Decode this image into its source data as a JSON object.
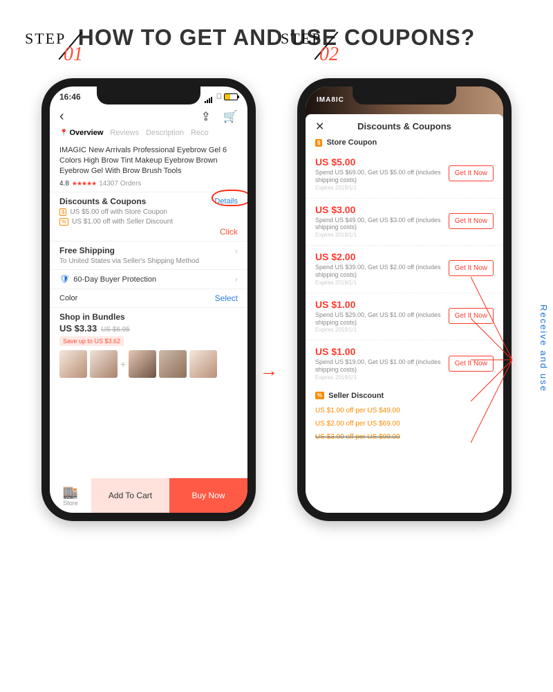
{
  "title": "HOW TO GET AND USE COUPONS?",
  "step1": {
    "word": "STEP",
    "num": "01"
  },
  "step2": {
    "word": "STEP",
    "num": "02"
  },
  "arrow": "→",
  "vtext": "Receive and use",
  "phone1": {
    "time": "16:46",
    "tabs": {
      "overview": "Overview",
      "reviews": "Reviews",
      "description": "Description",
      "rec": "Reco"
    },
    "product_title": "IMAGIC New Arrivals  Professional Eyebrow Gel 6 Colors High Brow Tint Makeup Eyebrow Brown Eyebrow Gel With Brow Brush Tools",
    "rating": "4.8",
    "stars": "★★★★★",
    "orders": "14307 Orders",
    "dc_heading": "Discounts & Coupons",
    "dc_line1": "US $5.00 off with Store Coupon",
    "dc_line2": "US $1.00 off with Seller Discount",
    "details": "Details",
    "click": "Click",
    "fs_heading": "Free Shipping",
    "fs_sub": "To United States via Seller's Shipping Method",
    "buyer_prot": "60-Day Buyer Protection",
    "color_label": "Color",
    "select": "Select",
    "bundles_heading": "Shop in Bundles",
    "bundle_price": "US $3.33",
    "bundle_old": "US $6.95",
    "bundle_save": "Save up to US $3.62",
    "store": "Store",
    "add_to_cart": "Add To Cart",
    "buy_now": "Buy Now"
  },
  "phone2": {
    "brand": "IMA8IC",
    "title": "Discounts & Coupons",
    "store_coupon_label": "Store Coupon",
    "coupons": [
      {
        "amt": "US $5.00",
        "cond": "Spend US $69.00, Get US $5.00 off (includes shipping costs)",
        "exp": "Expires 2019/1/1",
        "btn": "Get It Now"
      },
      {
        "amt": "US $3.00",
        "cond": "Spend US $49.00, Get US $3.00 off (includes shipping costs)",
        "exp": "Expires 2019/1/1",
        "btn": "Get It Now"
      },
      {
        "amt": "US $2.00",
        "cond": "Spend US $39.00, Get US $2.00 off (includes shipping costs)",
        "exp": "Expires 2019/1/1",
        "btn": "Get It Now"
      },
      {
        "amt": "US $1.00",
        "cond": "Spend US $29.00, Get US $1.00 off (includes shipping costs)",
        "exp": "Expires 2019/1/1",
        "btn": "Get It Now"
      },
      {
        "amt": "US $1.00",
        "cond": "Spend US $19.00, Get US $1.00 off (includes shipping costs)",
        "exp": "Expires 2019/1/1",
        "btn": "Get It Now"
      }
    ],
    "seller_discount_label": "Seller Discount",
    "sd": [
      "US $1.00 off per US $49.00",
      "US $2.00 off per US $69.00",
      "US $3.00 off per US $99.00"
    ]
  }
}
